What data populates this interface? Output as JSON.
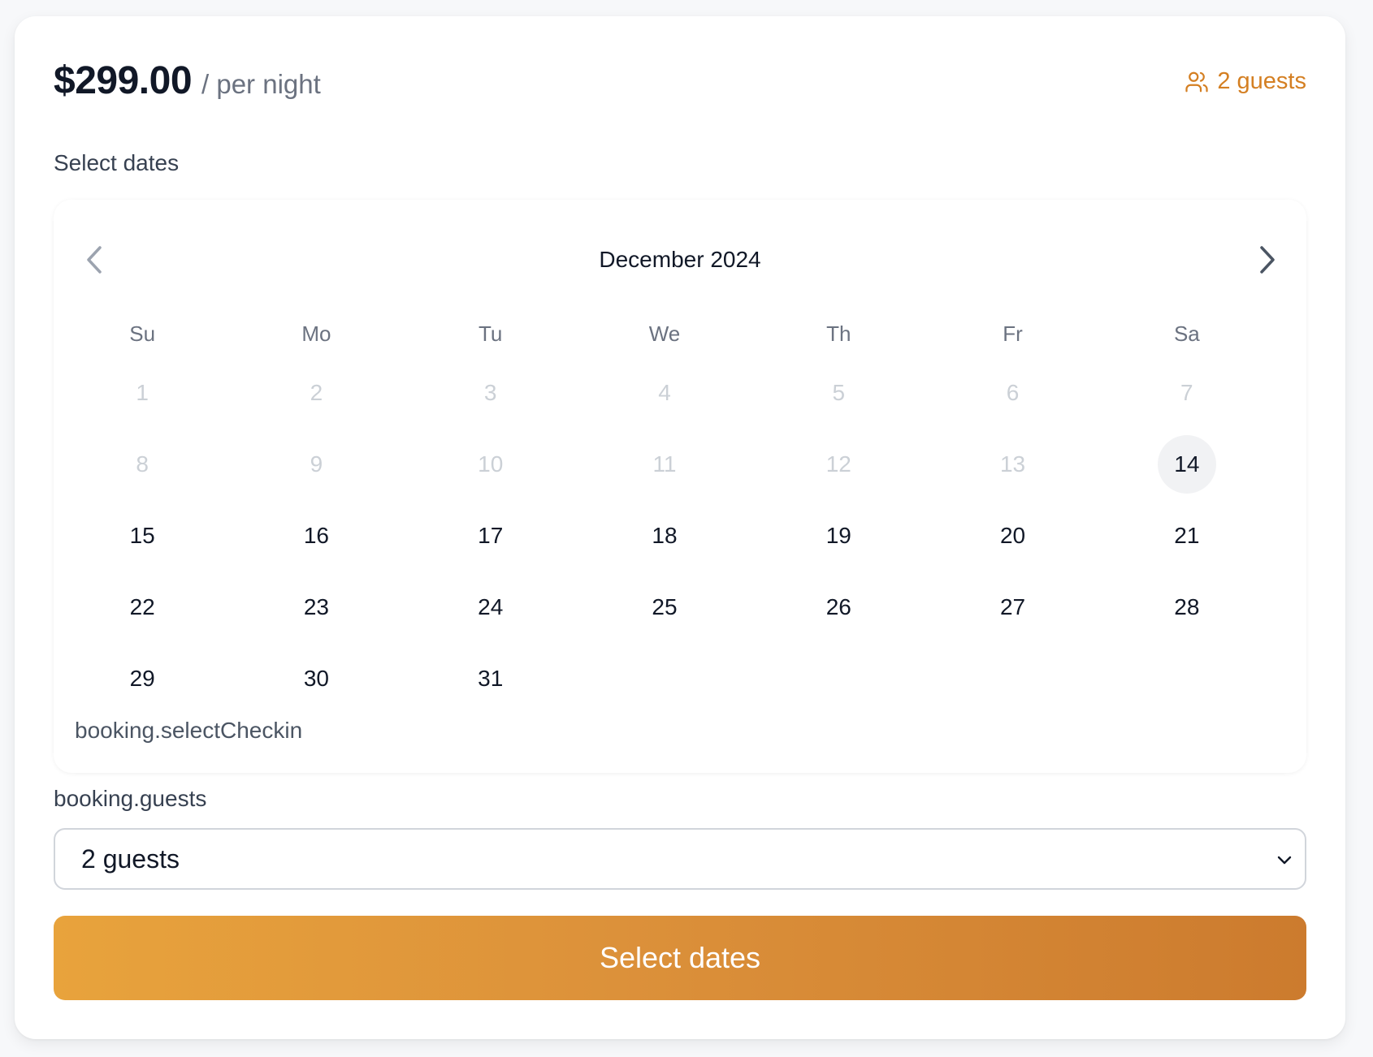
{
  "pricing": {
    "amount": "$299.00",
    "unit": "/ per night"
  },
  "guests_badge": {
    "icon": "users-icon",
    "label": "2 guests"
  },
  "dates_section": {
    "label": "Select dates"
  },
  "calendar": {
    "month_label": "December 2024",
    "prev_icon": "chevron-left-icon",
    "next_icon": "chevron-right-icon",
    "weekdays": [
      "Su",
      "Mo",
      "Tu",
      "We",
      "Th",
      "Fr",
      "Sa"
    ],
    "days": [
      {
        "label": "1",
        "state": "disabled"
      },
      {
        "label": "2",
        "state": "disabled"
      },
      {
        "label": "3",
        "state": "disabled"
      },
      {
        "label": "4",
        "state": "disabled"
      },
      {
        "label": "5",
        "state": "disabled"
      },
      {
        "label": "6",
        "state": "disabled"
      },
      {
        "label": "7",
        "state": "disabled"
      },
      {
        "label": "8",
        "state": "disabled"
      },
      {
        "label": "9",
        "state": "disabled"
      },
      {
        "label": "10",
        "state": "disabled"
      },
      {
        "label": "11",
        "state": "disabled"
      },
      {
        "label": "12",
        "state": "disabled"
      },
      {
        "label": "13",
        "state": "disabled"
      },
      {
        "label": "14",
        "state": "today"
      },
      {
        "label": "15",
        "state": "available"
      },
      {
        "label": "16",
        "state": "available"
      },
      {
        "label": "17",
        "state": "available"
      },
      {
        "label": "18",
        "state": "available"
      },
      {
        "label": "19",
        "state": "available"
      },
      {
        "label": "20",
        "state": "available"
      },
      {
        "label": "21",
        "state": "available"
      },
      {
        "label": "22",
        "state": "available"
      },
      {
        "label": "23",
        "state": "available"
      },
      {
        "label": "24",
        "state": "available"
      },
      {
        "label": "25",
        "state": "available"
      },
      {
        "label": "26",
        "state": "available"
      },
      {
        "label": "27",
        "state": "available"
      },
      {
        "label": "28",
        "state": "available"
      },
      {
        "label": "29",
        "state": "available"
      },
      {
        "label": "30",
        "state": "available"
      },
      {
        "label": "31",
        "state": "available"
      }
    ],
    "helper_text": "booking.selectCheckin"
  },
  "guests_field": {
    "label": "booking.guests",
    "selected_value": "2 guests",
    "chevron_icon": "chevron-down-icon"
  },
  "cta": {
    "label": "Select dates"
  },
  "colors": {
    "accent": "#d47f22",
    "cta_gradient_start": "#e8a33c",
    "cta_gradient_end": "#cc7b2e"
  }
}
